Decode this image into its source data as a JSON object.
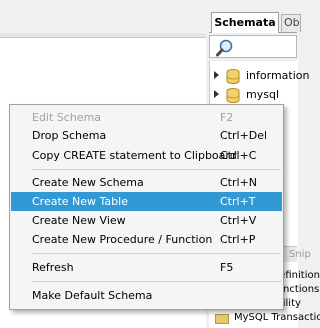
{
  "schemata_panel": {
    "tab_label": "Schemata",
    "other_tab_label": "Ob",
    "search_placeholder": "",
    "tree_items": [
      {
        "label": "information"
      },
      {
        "label": "mysql"
      }
    ]
  },
  "bottom_panel": {
    "tab_label": "Snip",
    "folders": [
      {
        "label": "MySQL Definitions"
      },
      {
        "label": "MySQL Functions"
      },
      {
        "label": "MySQL Utility"
      },
      {
        "label": "MySQL Transactions"
      }
    ]
  },
  "context_menu": {
    "groups": [
      [
        {
          "label": "Edit Schema",
          "shortcut": "F2",
          "disabled": true
        },
        {
          "label": "Drop Schema",
          "shortcut": "Ctrl+Del"
        },
        {
          "label": "Copy CREATE statement to Clipboard",
          "shortcut": "Ctrl+C"
        }
      ],
      [
        {
          "label": "Create New Schema",
          "shortcut": "Ctrl+N"
        },
        {
          "label": "Create New Table",
          "shortcut": "Ctrl+T",
          "selected": true
        },
        {
          "label": "Create New View",
          "shortcut": "Ctrl+V"
        },
        {
          "label": "Create New Procedure / Function",
          "shortcut": "Ctrl+P"
        }
      ],
      [
        {
          "label": "Refresh",
          "shortcut": "F5"
        }
      ],
      [
        {
          "label": "Make Default Schema",
          "shortcut": ""
        }
      ]
    ]
  },
  "colors": {
    "selection": "#3399d4",
    "disabled_text": "#a0a0a0",
    "menu_background": "#f5f5f5"
  }
}
